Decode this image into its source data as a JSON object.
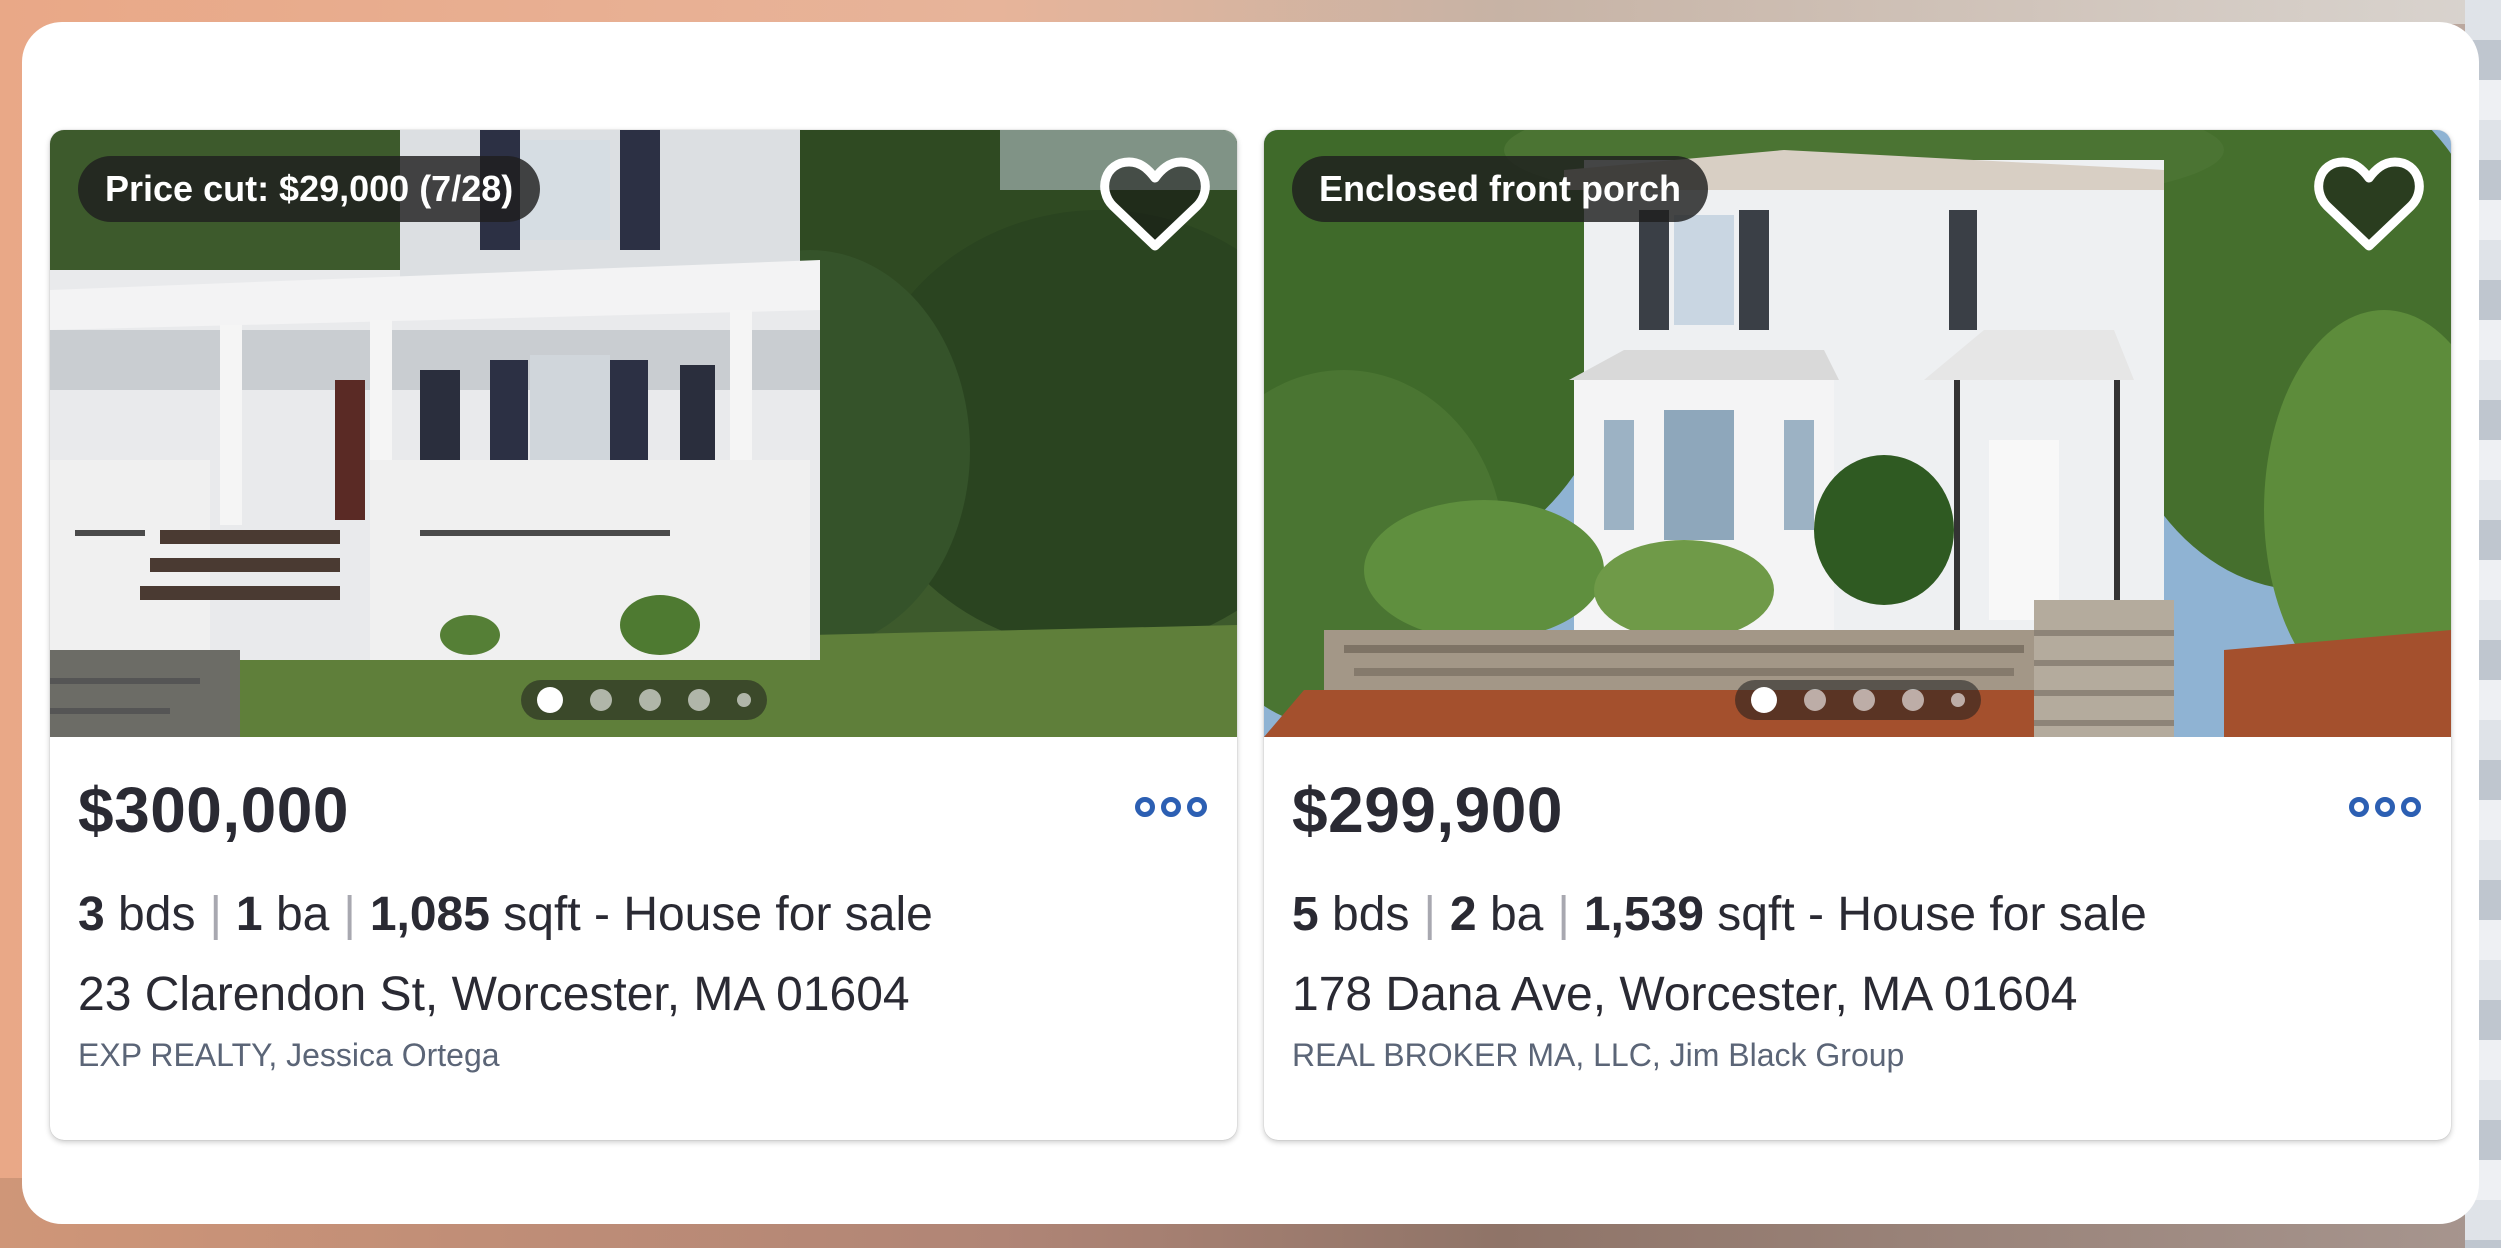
{
  "listings": [
    {
      "badge": "Price cut: $29,000 (7/28)",
      "price": "$300,000",
      "beds": "3",
      "beds_unit": "bds",
      "baths": "1",
      "baths_unit": "ba",
      "sqft": "1,085",
      "sqft_unit": "sqft",
      "type": "- House for sale",
      "address": "23 Clarendon St, Worcester, MA 01604",
      "broker": "EXP REALTY, Jessica Ortega",
      "photo_count_dots": 5,
      "active_photo": 1
    },
    {
      "badge": "Enclosed front porch",
      "price": "$299,900",
      "beds": "5",
      "beds_unit": "bds",
      "baths": "2",
      "baths_unit": "ba",
      "sqft": "1,539",
      "sqft_unit": "sqft",
      "type": "- House for sale",
      "address": "178 Dana Ave, Worcester, MA 01604",
      "broker": "REAL BROKER MA, LLC, Jim Black Group",
      "photo_count_dots": 5,
      "active_photo": 1
    }
  ],
  "separator": "|",
  "icons": {
    "favorite": "heart-outline-icon",
    "more": "more-options-icon"
  },
  "colors": {
    "accent": "#2c5fb3",
    "text": "#2a2a33",
    "muted": "#5b6577"
  }
}
